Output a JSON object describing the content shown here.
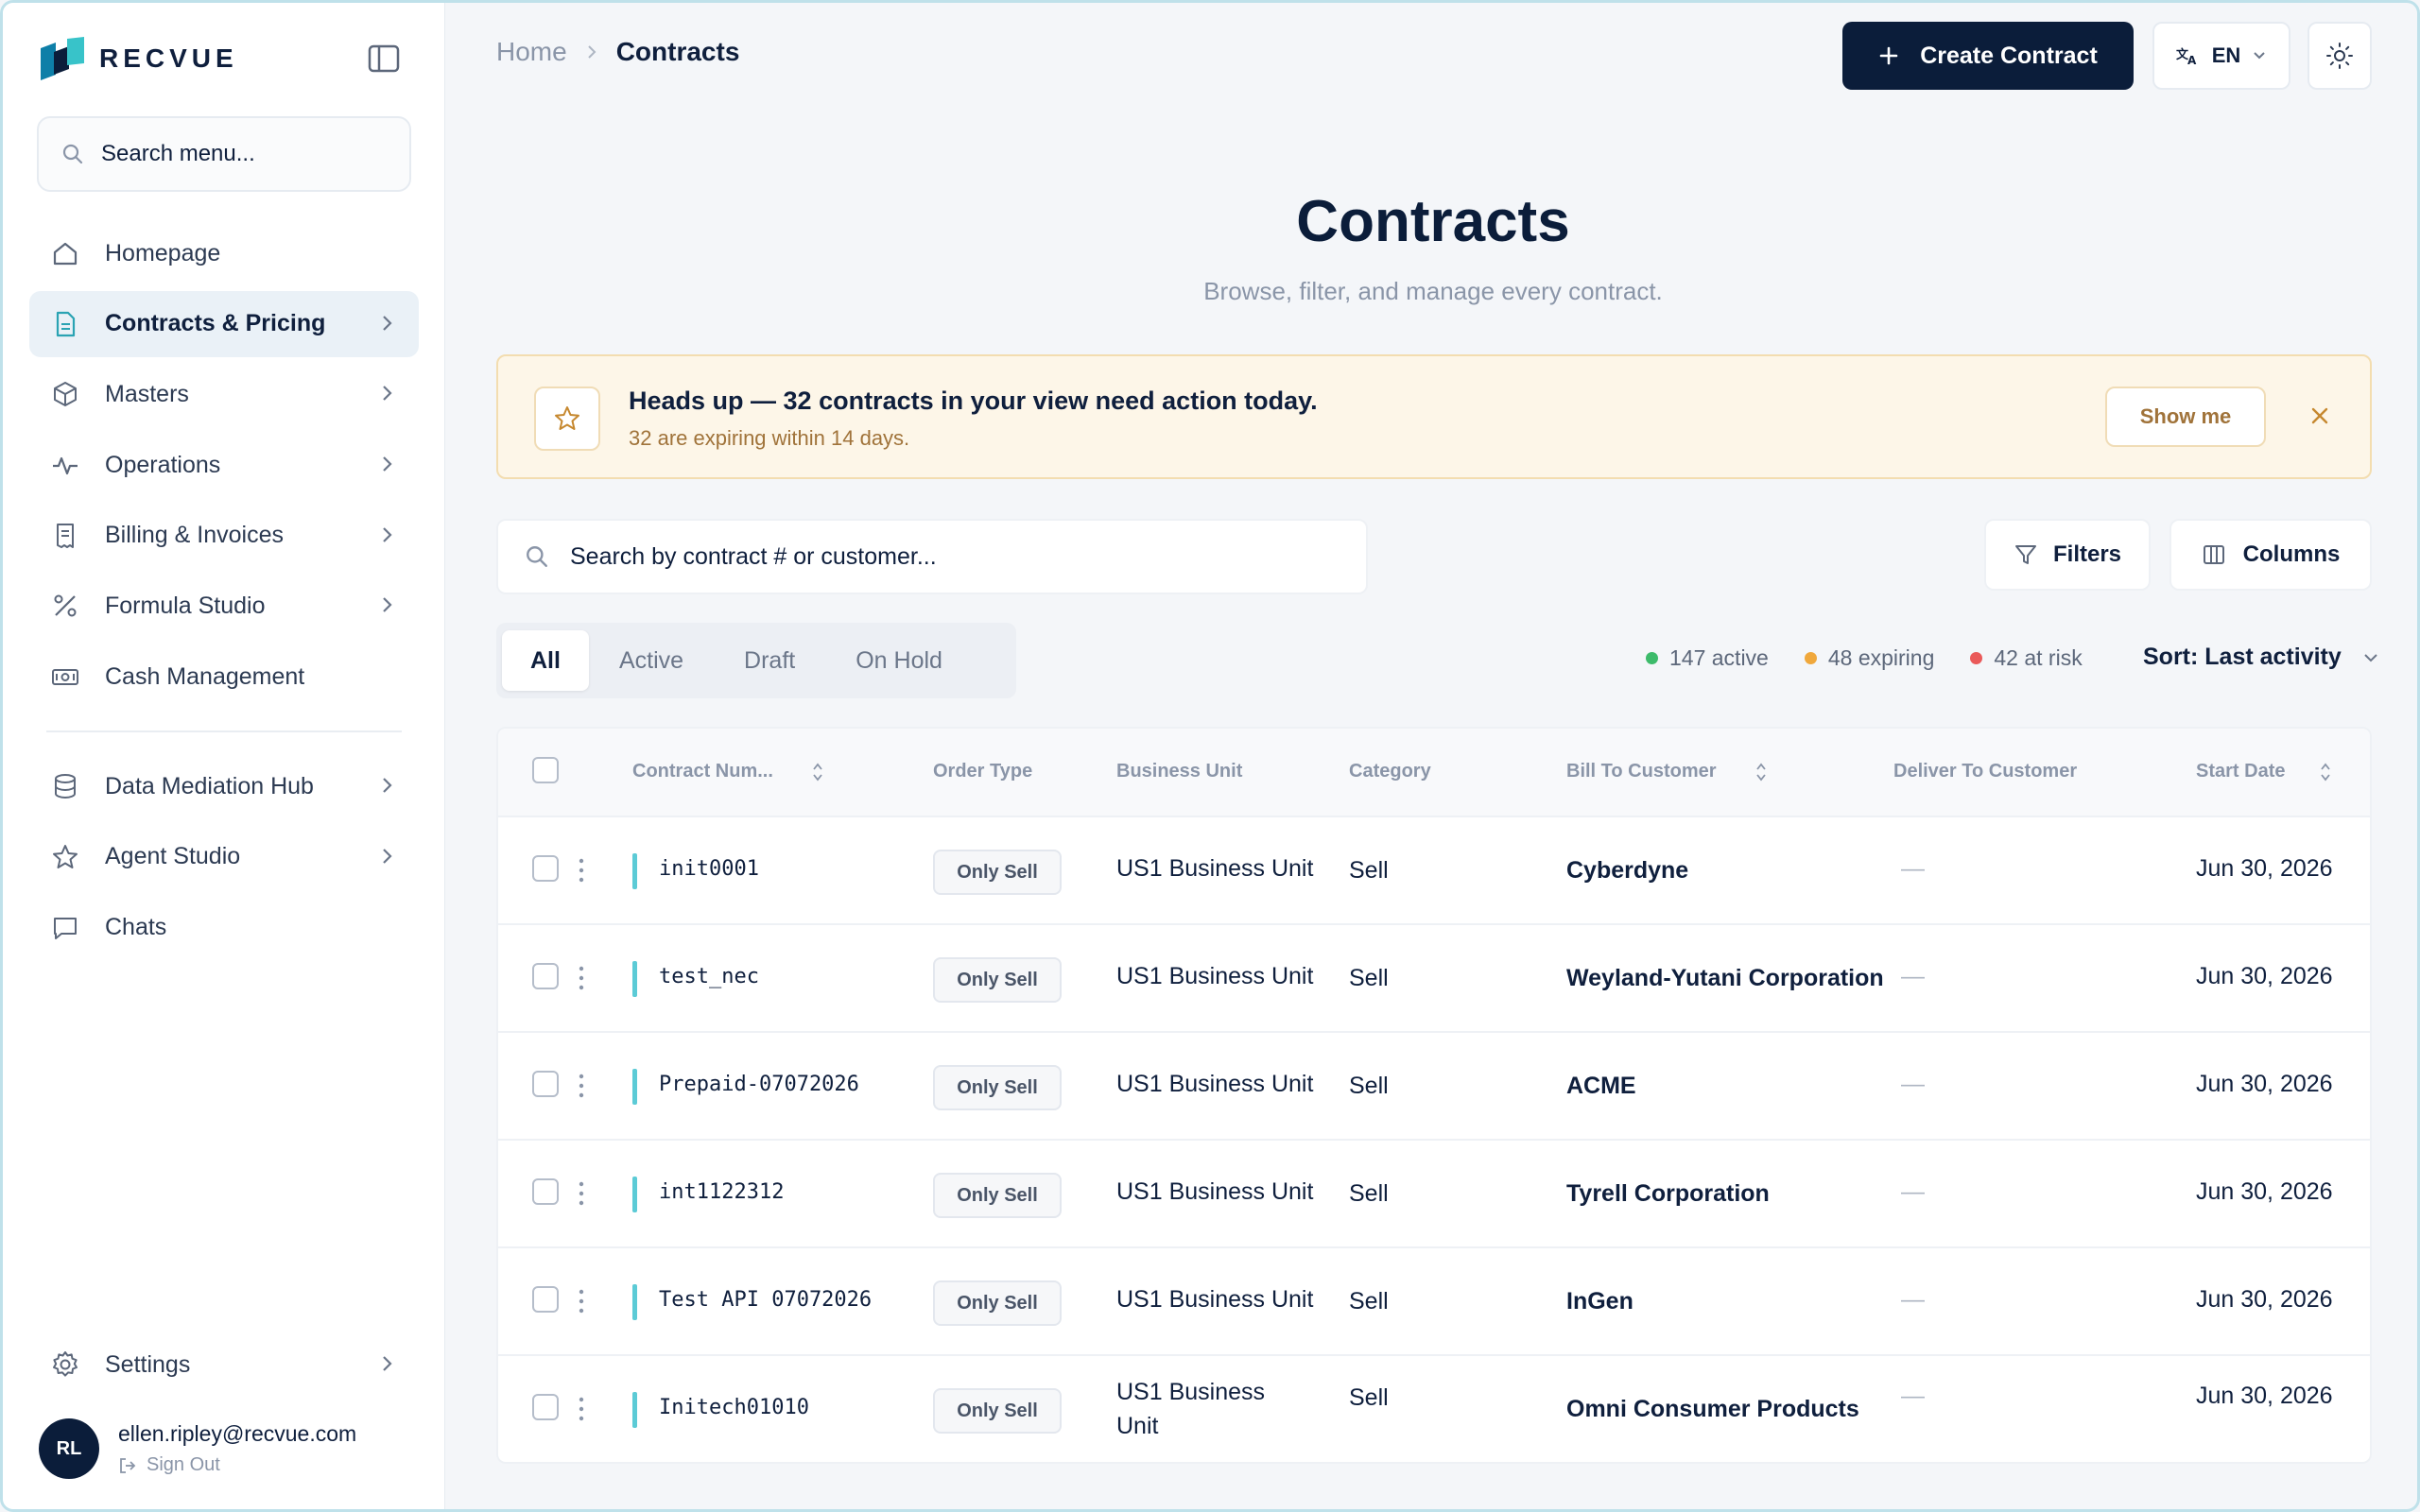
{
  "brand": {
    "name": "RECVUE"
  },
  "sidebar": {
    "search_placeholder": "Search menu...",
    "items": [
      {
        "label": "Homepage",
        "icon": "home-icon",
        "chevron": false,
        "active": false
      },
      {
        "label": "Contracts & Pricing",
        "icon": "document-icon",
        "chevron": true,
        "active": true
      },
      {
        "label": "Masters",
        "icon": "cube-icon",
        "chevron": true,
        "active": false
      },
      {
        "label": "Operations",
        "icon": "activity-icon",
        "chevron": true,
        "active": false
      },
      {
        "label": "Billing & Invoices",
        "icon": "receipt-icon",
        "chevron": true,
        "active": false
      },
      {
        "label": "Formula Studio",
        "icon": "percent-icon",
        "chevron": true,
        "active": false
      },
      {
        "label": "Cash Management",
        "icon": "banknote-icon",
        "chevron": false,
        "active": false
      }
    ],
    "items_secondary": [
      {
        "label": "Data Mediation Hub",
        "icon": "database-icon",
        "chevron": true
      },
      {
        "label": "Agent Studio",
        "icon": "star-icon",
        "chevron": true
      },
      {
        "label": "Chats",
        "icon": "chat-icon",
        "chevron": false
      }
    ],
    "settings_label": "Settings",
    "user": {
      "initials": "RL",
      "email": "ellen.ripley@recvue.com",
      "signout": "Sign Out"
    }
  },
  "header": {
    "breadcrumb_home": "Home",
    "breadcrumb_current": "Contracts",
    "create_label": "Create Contract",
    "language": "EN"
  },
  "page": {
    "title": "Contracts",
    "subtitle": "Browse, filter, and manage every contract."
  },
  "alert": {
    "title": "Heads up — 32 contracts in your view need action today.",
    "subtitle": "32 are expiring within 14 days.",
    "action": "Show me"
  },
  "toolbar": {
    "search_placeholder": "Search by contract # or customer...",
    "filters_label": "Filters",
    "columns_label": "Columns"
  },
  "tabs": [
    "All",
    "Active",
    "Draft",
    "On Hold"
  ],
  "stats": [
    {
      "label": "147 active",
      "color": "#3dbb6b"
    },
    {
      "label": "48 expiring",
      "color": "#f0a83c"
    },
    {
      "label": "42 at risk",
      "color": "#ea5a5a"
    }
  ],
  "sort_label": "Sort: Last activity",
  "table": {
    "columns": [
      "Contract Num...",
      "Order Type",
      "Business Unit",
      "Category",
      "Bill To Customer",
      "Deliver To Customer",
      "Start Date"
    ],
    "rows": [
      {
        "contract": "init0001",
        "order_type": "Only Sell",
        "business_unit": "US1 Business Unit",
        "category": "Sell",
        "bill_to": "Cyberdyne",
        "deliver_to": "—",
        "start_date": "Jun 30, 2026"
      },
      {
        "contract": "test_nec",
        "order_type": "Only Sell",
        "business_unit": "US1 Business Unit",
        "category": "Sell",
        "bill_to": "Weyland-Yutani Corporation",
        "deliver_to": "—",
        "start_date": "Jun 30, 2026"
      },
      {
        "contract": "Prepaid-07072026",
        "order_type": "Only Sell",
        "business_unit": "US1 Business Unit",
        "category": "Sell",
        "bill_to": "ACME",
        "deliver_to": "—",
        "start_date": "Jun 30, 2026"
      },
      {
        "contract": "int1122312",
        "order_type": "Only Sell",
        "business_unit": "US1 Business Unit",
        "category": "Sell",
        "bill_to": "Tyrell Corporation",
        "deliver_to": "—",
        "start_date": "Jun 30, 2026"
      },
      {
        "contract": "Test API 07072026",
        "order_type": "Only Sell",
        "business_unit": "US1 Business Unit",
        "category": "Sell",
        "bill_to": "InGen",
        "deliver_to": "—",
        "start_date": "Jun 30, 2026"
      },
      {
        "contract": "Initech01010",
        "order_type": "Only Sell",
        "business_unit": "US1 Business Unit",
        "category": "Sell",
        "bill_to": "Omni Consumer Products",
        "deliver_to": "—",
        "start_date": "Jun 30, 2026"
      }
    ]
  }
}
